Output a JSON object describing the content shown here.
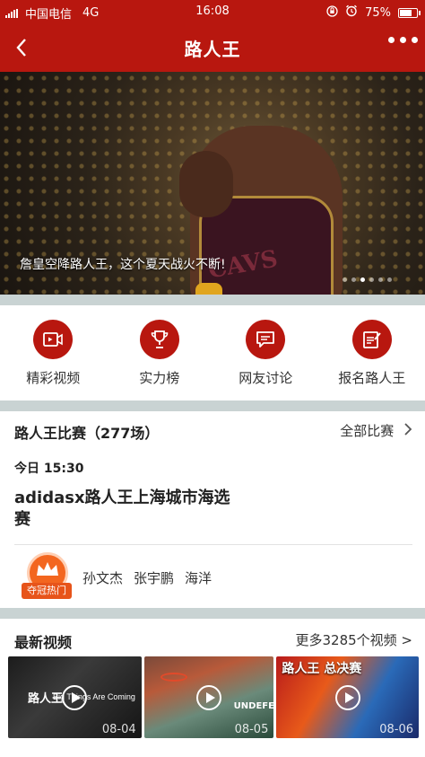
{
  "status_bar": {
    "carrier": "中国电信",
    "network": "4G",
    "time": "16:08",
    "battery": "75%",
    "battery_level": 0.75
  },
  "nav": {
    "title": "路人王"
  },
  "banner": {
    "caption": "詹皇空降路人王，这个夏天战火不断!",
    "dots": 6,
    "active_dot": 2,
    "jersey_text": "CAVS"
  },
  "quick_actions": [
    {
      "label": "精彩视频",
      "icon": "video-icon"
    },
    {
      "label": "实力榜",
      "icon": "trophy-icon"
    },
    {
      "label": "网友讨论",
      "icon": "chat-icon"
    },
    {
      "label": "报名路人王",
      "icon": "edit-icon"
    }
  ],
  "matches": {
    "heading": "路人王比赛（277场）",
    "all_link": "全部比赛",
    "time": "今日 15:30",
    "title": "adidasx路人王上海城市海选赛",
    "badge": "夺冠热门",
    "players": [
      "孙文杰",
      "张宇鹏",
      "海洋"
    ]
  },
  "videos": {
    "heading": "最新视频",
    "more_link": "更多3285个视频 >",
    "items": [
      {
        "date": "08-04",
        "brand": "路人王",
        "caption": "Big Things Are Coming"
      },
      {
        "date": "08-05",
        "brand": "UNDEFEATED"
      },
      {
        "date": "08-06",
        "brand": "路人王 总决赛"
      }
    ]
  },
  "colors": {
    "brand_red": "#b8170f",
    "divider": "#c9d3d3",
    "badge_orange": "#f3661f"
  }
}
